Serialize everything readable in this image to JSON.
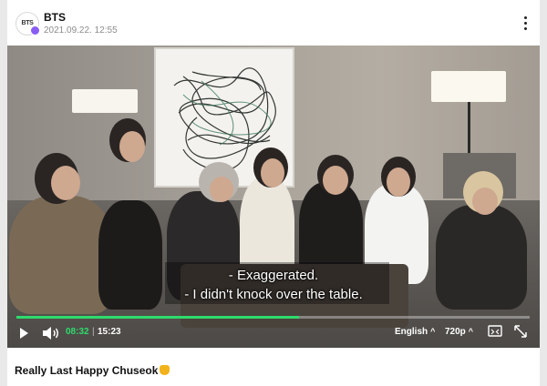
{
  "header": {
    "avatar_text": "BTS",
    "channel_name": "BTS",
    "post_time": "2021.09.22. 12:55",
    "verified_color": "#8a5cf6"
  },
  "video": {
    "subtitle_lines": [
      "- Exaggerated.",
      "- I didn't knock over the table."
    ],
    "progress_fraction": 0.55,
    "accent_color": "#2edb6b",
    "time_current": "08:32",
    "time_separator": "|",
    "time_total": "15:23",
    "language": "English",
    "quality": "720p",
    "icons": [
      "play-icon",
      "volume-icon",
      "subtitles-icon",
      "fullscreen-icon"
    ]
  },
  "post": {
    "title": "Really Last Happy Chuseok",
    "title_emoji": "victory-hand-emoji"
  }
}
